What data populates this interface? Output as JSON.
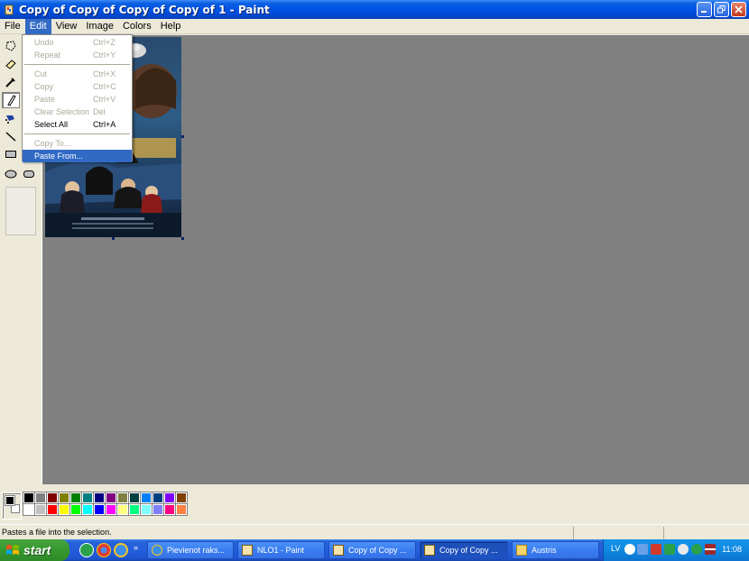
{
  "window": {
    "title": "Copy of Copy of Copy of Copy of 1 - Paint"
  },
  "menubar": {
    "items": [
      "File",
      "Edit",
      "View",
      "Image",
      "Colors",
      "Help"
    ],
    "active": "Edit"
  },
  "edit_menu": {
    "items": [
      {
        "label": "Undo",
        "shortcut": "Ctrl+Z",
        "enabled": false
      },
      {
        "label": "Repeat",
        "shortcut": "Ctrl+Y",
        "enabled": false
      },
      {
        "label": "Cut",
        "shortcut": "Ctrl+X",
        "enabled": false
      },
      {
        "label": "Copy",
        "shortcut": "Ctrl+C",
        "enabled": false
      },
      {
        "label": "Paste",
        "shortcut": "Ctrl+V",
        "enabled": false
      },
      {
        "label": "Clear Selection",
        "shortcut": "Del",
        "enabled": false
      },
      {
        "label": "Select All",
        "shortcut": "Ctrl+A",
        "enabled": true
      },
      {
        "label": "Copy To...",
        "shortcut": "",
        "enabled": false
      },
      {
        "label": "Paste From...",
        "shortcut": "",
        "enabled": true,
        "highlighted": true
      }
    ]
  },
  "toolbox": {
    "tools": [
      "free-form-select-icon",
      "eraser-icon",
      "color-picker-icon",
      "pencil-icon",
      "airbrush-icon",
      "line-icon",
      "rectangle-icon",
      "ellipse-icon",
      "rounded-rectangle-icon"
    ],
    "selected": "pencil-icon"
  },
  "canvas": {
    "background": "#808080",
    "picture_theme": "movie-poster"
  },
  "palette": {
    "foreground": "#000000",
    "background": "#ffffff",
    "colors": [
      "#000000",
      "#808080",
      "#800000",
      "#808000",
      "#008000",
      "#008080",
      "#000080",
      "#800080",
      "#808040",
      "#004040",
      "#0080ff",
      "#004080",
      "#8000ff",
      "#804000",
      "#ffffff",
      "#c0c0c0",
      "#ff0000",
      "#ffff00",
      "#00ff00",
      "#00ffff",
      "#0000ff",
      "#ff00ff",
      "#ffff80",
      "#00ff80",
      "#80ffff",
      "#8080ff",
      "#ff0080",
      "#ff8040"
    ]
  },
  "statusbar": {
    "text": "Pastes a file into the selection."
  },
  "taskbar": {
    "start_label": "start",
    "buttons": [
      {
        "label": "Pievienot raks...",
        "icon": "internet-explorer-icon",
        "active": false
      },
      {
        "label": "NLO1 - Paint",
        "icon": "paint-icon",
        "active": false
      },
      {
        "label": "Copy of Copy ...",
        "icon": "paint-icon",
        "active": false
      },
      {
        "label": "Copy of Copy ...",
        "icon": "paint-icon",
        "active": true
      },
      {
        "label": "Austris",
        "icon": "folder-icon",
        "active": false
      }
    ],
    "language": "LV",
    "clock": "11:08"
  }
}
